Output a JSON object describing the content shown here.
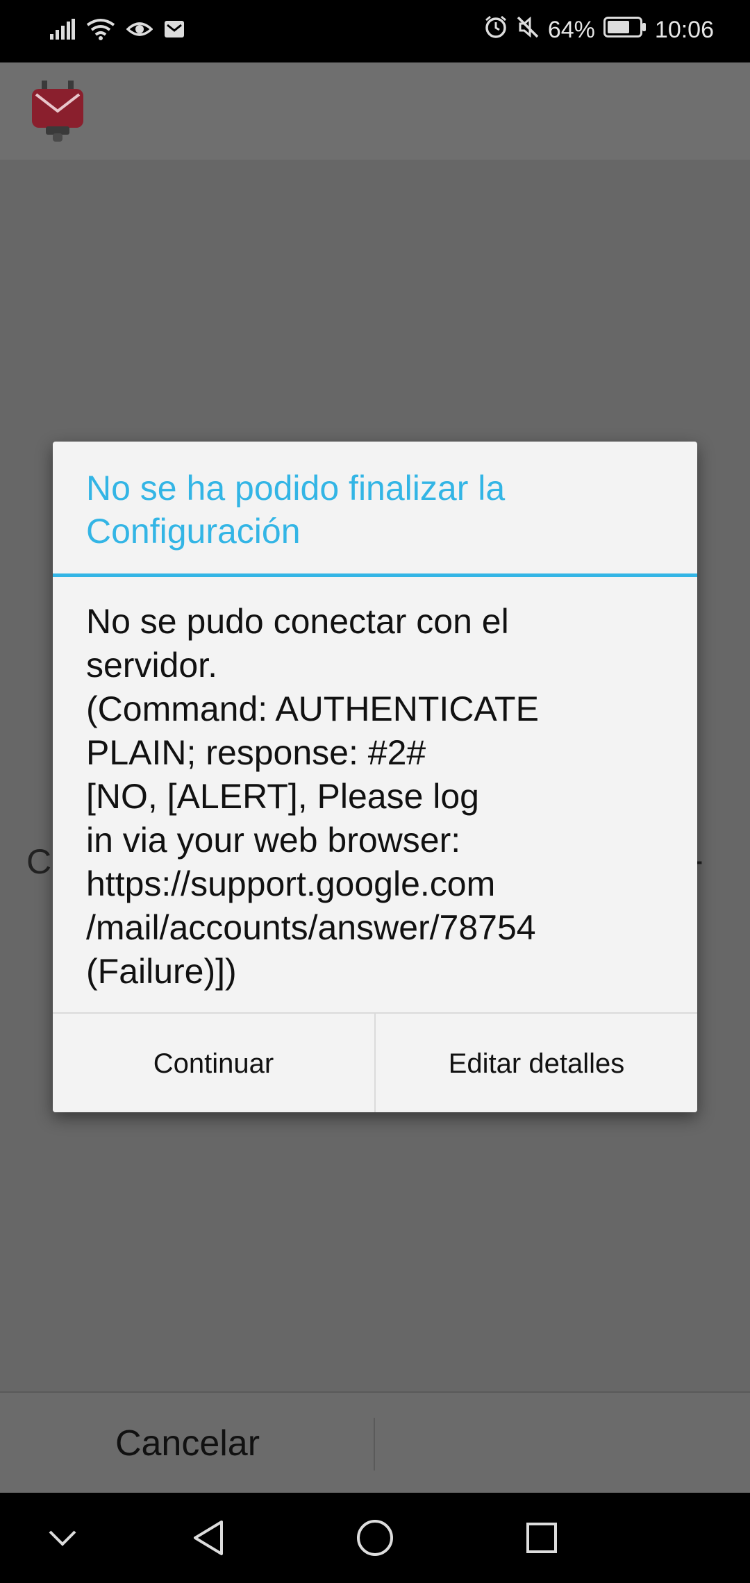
{
  "status_bar": {
    "battery_percent": "64%",
    "time": "10:06",
    "left_icons": [
      "signal-icon",
      "wifi-icon",
      "eye-comfort-icon",
      "mail-notification-icon"
    ],
    "right_icons": [
      "alarm-icon",
      "mute-icon",
      "battery-icon"
    ]
  },
  "app_bar": {
    "logo_icon": "k9-mail-logo-icon"
  },
  "dialog": {
    "title": "No se ha podido finalizar la Configuración",
    "message": "No se pudo conectar con el\nservidor.\n(Command: AUTHENTICATE\nPLAIN; response: #2#\n[NO, [ALERT], Please log\nin via your web browser:\nhttps://support.google.com\n/mail/accounts/answer/78754\n(Failure)])",
    "buttons": {
      "continue_label": "Continuar",
      "edit_label": "Editar detalles"
    },
    "accent_color": "#33b5e5"
  },
  "bottom_bar": {
    "cancel_label": "Cancelar"
  },
  "nav_bar": {
    "icons": [
      "chevron-down-icon",
      "back-icon",
      "home-icon",
      "recents-icon"
    ]
  }
}
